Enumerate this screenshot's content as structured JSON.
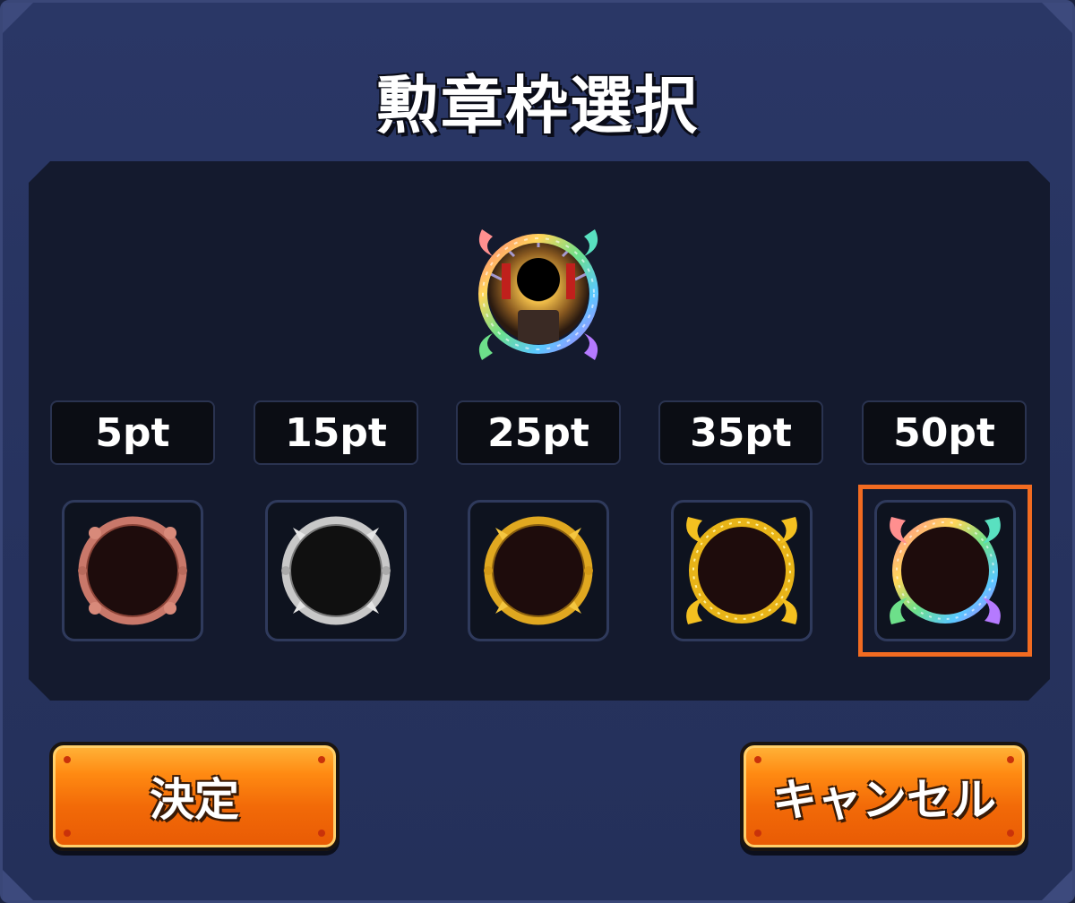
{
  "dialog": {
    "title": "勲章枠選択"
  },
  "preview": {
    "icon": "rainbow-medal-frame-preview"
  },
  "frames": [
    {
      "points": "5pt",
      "icon": "bronze-frame-icon",
      "color": "#c9786a"
    },
    {
      "points": "15pt",
      "icon": "silver-frame-icon",
      "color": "#bfbfbf"
    },
    {
      "points": "25pt",
      "icon": "gold-frame-icon",
      "color": "#e0a820"
    },
    {
      "points": "35pt",
      "icon": "gold-horned-frame-icon",
      "color": "#e8b418"
    },
    {
      "points": "50pt",
      "icon": "rainbow-horned-frame-icon",
      "color": "rainbow",
      "selected": true
    }
  ],
  "buttons": {
    "confirm_label": "決定",
    "cancel_label": "キャンセル"
  },
  "colors": {
    "selection_border": "#f26b21",
    "button_orange": "#f26a08",
    "dialog_bg": "#27335f"
  }
}
